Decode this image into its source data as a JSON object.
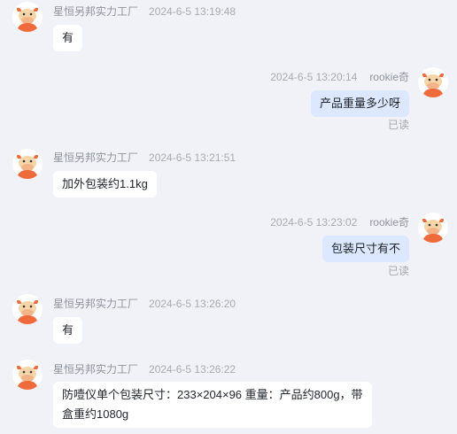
{
  "messages": [
    {
      "side": "left",
      "sender": "星恒另邦实力工厂",
      "time": "2024-6-5 13:19:48",
      "text": "有"
    },
    {
      "side": "right",
      "sender": "rookie奇",
      "time": "2024-6-5 13:20:14",
      "text": "产品重量多少呀",
      "status": "已读"
    },
    {
      "side": "left",
      "sender": "星恒另邦实力工厂",
      "time": "2024-6-5 13:21:51",
      "text": "加外包装约1.1kg"
    },
    {
      "side": "right",
      "sender": "rookie奇",
      "time": "2024-6-5 13:23:02",
      "text": "包装尺寸有不",
      "status": "已读"
    },
    {
      "side": "left",
      "sender": "星恒另邦实力工厂",
      "time": "2024-6-5 13:26:20",
      "text": "有"
    },
    {
      "side": "left",
      "sender": "星恒另邦实力工厂",
      "time": "2024-6-5 13:26:22",
      "text": "防噎仪单个包装尺寸：233×204×96 重量：产品约800g，带盒重约1080g"
    }
  ],
  "icons": {
    "avatar": "cartoon-bull-avatar-icon"
  },
  "colors": {
    "background": "#f0f2f7",
    "bubble_left": "#ffffff",
    "bubble_right": "#dce8ff",
    "avatar_orange": "#f06b3b"
  }
}
